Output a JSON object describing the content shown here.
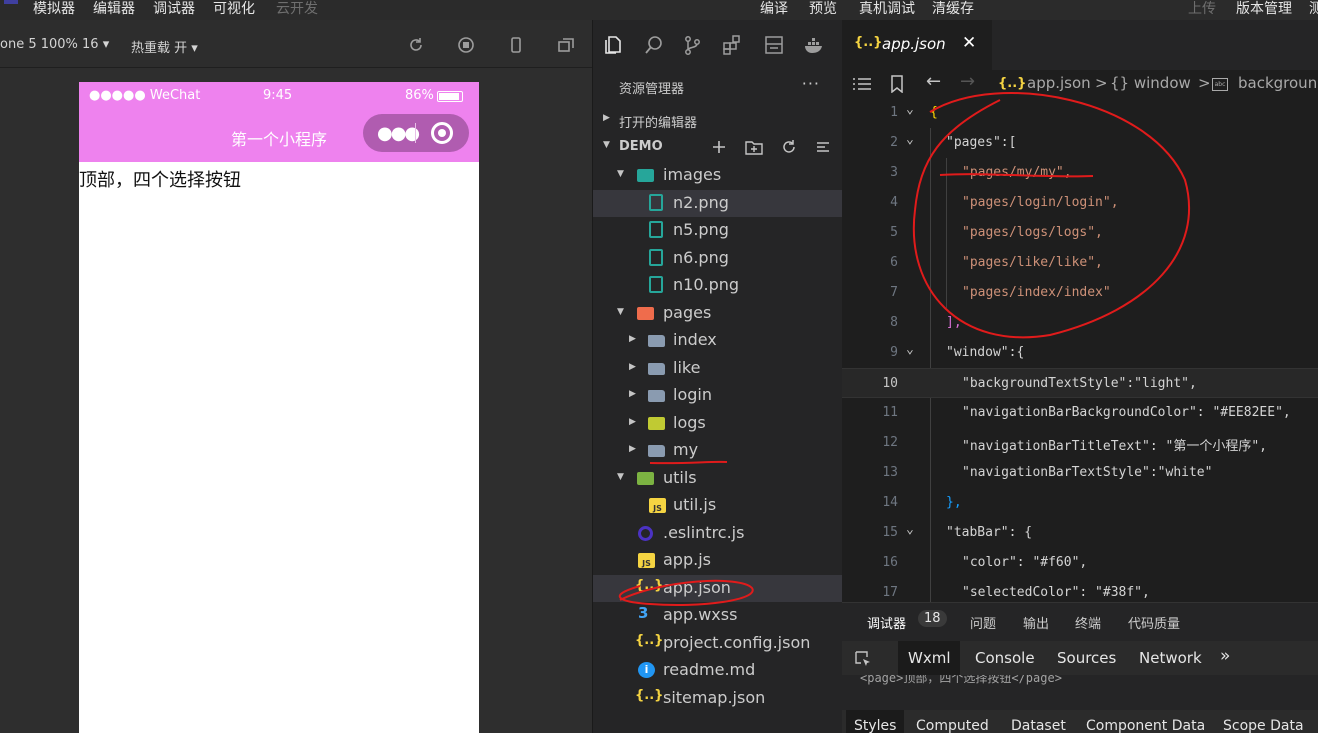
{
  "menubar": {
    "items": [
      "模拟器",
      "编辑器",
      "调试器",
      "可视化",
      "云开发"
    ],
    "right_items": [
      "编译",
      "预览",
      "真机调试",
      "清缓存"
    ],
    "far_right": [
      "上传",
      "版本管理",
      "测"
    ]
  },
  "simulator": {
    "device_label": "one 5 100% 16 ▾",
    "hot_reload": "热重载 开 ▾",
    "status": {
      "signal": "●●●●● WeChat",
      "time": "9:45",
      "battery": "86%"
    },
    "nav_title": "第一个小程序",
    "page_text": "顶部，四个选择按钮"
  },
  "explorer": {
    "title": "资源管理器",
    "more": "···",
    "open_editors": "打开的编辑器",
    "project": "DEMO",
    "tree": [
      {
        "label": "images",
        "icon": "folder-images-icon"
      },
      {
        "label": "n2.png",
        "icon": "image-file-icon"
      },
      {
        "label": "n5.png",
        "icon": "image-file-icon"
      },
      {
        "label": "n6.png",
        "icon": "image-file-icon"
      },
      {
        "label": "n10.png",
        "icon": "image-file-icon"
      },
      {
        "label": "pages",
        "icon": "folder-pages-icon"
      },
      {
        "label": "index",
        "icon": "folder-icon"
      },
      {
        "label": "like",
        "icon": "folder-icon"
      },
      {
        "label": "login",
        "icon": "folder-icon"
      },
      {
        "label": "logs",
        "icon": "folder-logs-icon"
      },
      {
        "label": "my",
        "icon": "folder-icon"
      },
      {
        "label": "utils",
        "icon": "folder-utils-icon"
      },
      {
        "label": "util.js",
        "icon": "js-file-icon"
      },
      {
        "label": ".eslintrc.js",
        "icon": "eslint-file-icon"
      },
      {
        "label": "app.js",
        "icon": "js-file-icon"
      },
      {
        "label": "app.json",
        "icon": "json-file-icon"
      },
      {
        "label": "app.wxss",
        "icon": "css-file-icon"
      },
      {
        "label": "project.config.json",
        "icon": "json-file-icon"
      },
      {
        "label": "readme.md",
        "icon": "info-file-icon"
      },
      {
        "label": "sitemap.json",
        "icon": "json-file-icon"
      }
    ]
  },
  "editor": {
    "tab_icon": "{..}",
    "tab_name": "app.json",
    "tab_close": "✕",
    "breadcrumb": {
      "file": "app.json",
      "sep1": ">",
      "obj": "{} window",
      "sep2": ">",
      "prop": "backgrounc"
    },
    "lines": [
      {
        "n": "1",
        "text": "{"
      },
      {
        "n": "2",
        "text": "\"pages\":["
      },
      {
        "n": "3",
        "text": "\"pages/my/my\","
      },
      {
        "n": "4",
        "text": "\"pages/login/login\","
      },
      {
        "n": "5",
        "text": "\"pages/logs/logs\","
      },
      {
        "n": "6",
        "text": "\"pages/like/like\","
      },
      {
        "n": "7",
        "text": "\"pages/index/index\""
      },
      {
        "n": "8",
        "text": "],"
      },
      {
        "n": "9",
        "text": "\"window\":{"
      },
      {
        "n": "10",
        "text": "\"backgroundTextStyle\":\"light\","
      },
      {
        "n": "11",
        "text": "\"navigationBarBackgroundColor\": \"#EE82EE\","
      },
      {
        "n": "12",
        "text": "\"navigationBarTitleText\": \"第一个小程序\","
      },
      {
        "n": "13",
        "text": "\"navigationBarTextStyle\":\"white\""
      },
      {
        "n": "14",
        "text": "},"
      },
      {
        "n": "15",
        "text": "\"tabBar\": {"
      },
      {
        "n": "16",
        "text": "\"color\": \"#f60\","
      },
      {
        "n": "17",
        "text": "\"selectedColor\": \"#38f\","
      }
    ]
  },
  "devtools": {
    "tabs": [
      "调试器",
      "问题",
      "输出",
      "终端",
      "代码质量"
    ],
    "badge": "18",
    "sub_tabs": [
      "Wxml",
      "Console",
      "Sources",
      "Network",
      "»"
    ],
    "wxml_preview": "<page>顶部，四个选择按钮</page>",
    "bottom_tabs": [
      "Styles",
      "Computed",
      "Dataset",
      "Component Data",
      "Scope Data"
    ]
  },
  "colors": {
    "nav_background": "#EE82EE",
    "annotation_red": "#e01b1b"
  }
}
